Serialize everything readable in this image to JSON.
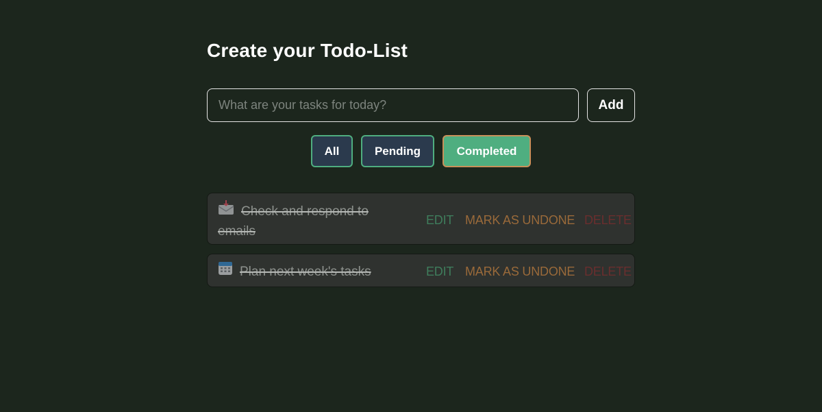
{
  "page": {
    "title": "Create your Todo-List"
  },
  "task_input": {
    "placeholder": "What are your tasks for today?",
    "value": ""
  },
  "add_button": {
    "label": "Add"
  },
  "filters": [
    {
      "label": "All",
      "active": false
    },
    {
      "label": "Pending",
      "active": false
    },
    {
      "label": "Completed",
      "active": true
    }
  ],
  "tasks": [
    {
      "icon": "incoming-envelope-icon",
      "text": "Check and respond to emails",
      "completed": true,
      "edit_label": "EDIT",
      "toggle_label": "MARK AS UNDONE",
      "delete_label": "DELETE"
    },
    {
      "icon": "calendar-icon",
      "text": "Plan next week's tasks",
      "completed": true,
      "edit_label": "EDIT",
      "toggle_label": "MARK AS UNDONE",
      "delete_label": "DELETE"
    }
  ],
  "colors": {
    "background": "#1c261d",
    "task_card": "#2f322f",
    "filter_inactive": "#2b3a4d",
    "filter_active": "#4fae80",
    "edit": "#3f7d5c",
    "mark_undone": "#9a6a3a",
    "delete": "#6a2e2e"
  }
}
